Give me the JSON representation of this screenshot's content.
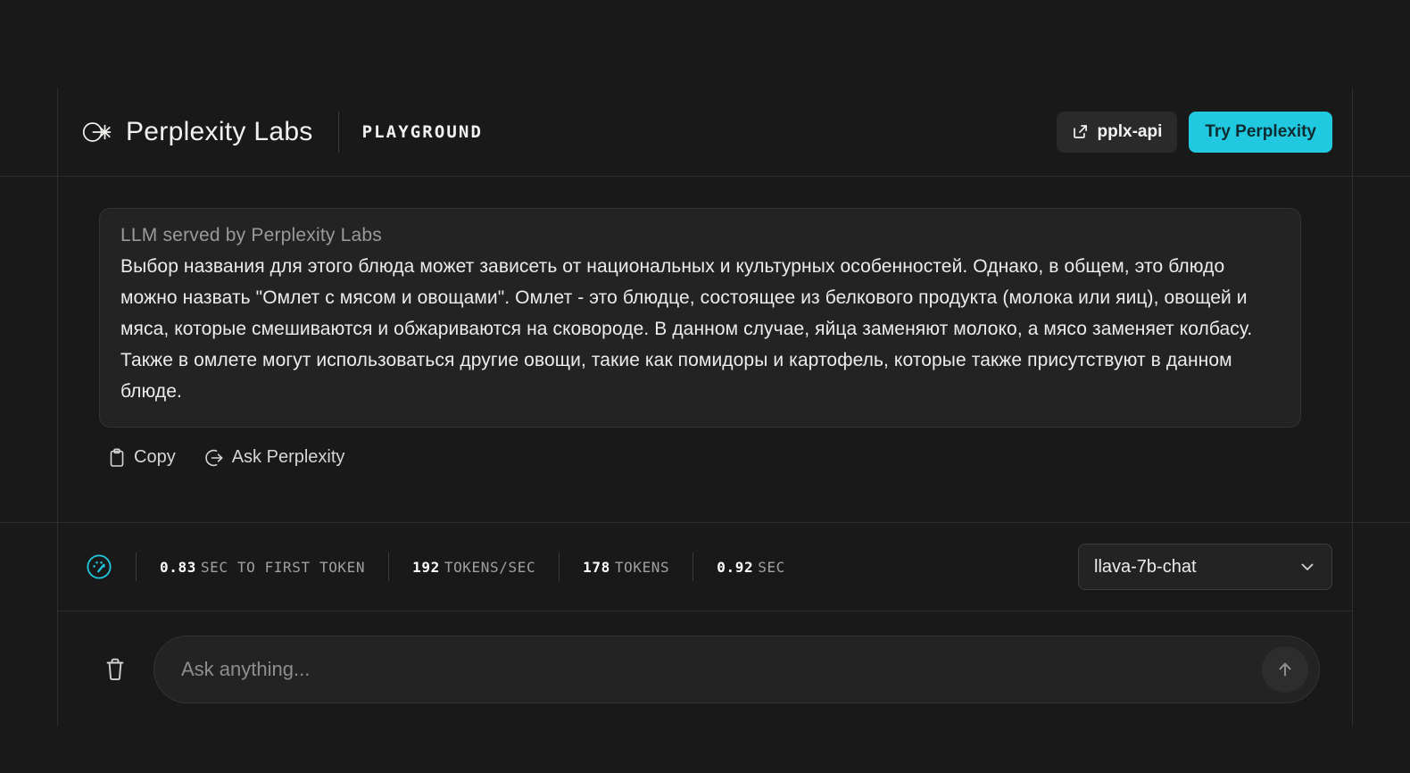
{
  "header": {
    "brand_name": "Perplexity Labs",
    "section_label": "PLAYGROUND",
    "api_button": "pplx-api",
    "try_button": "Try Perplexity",
    "accent_color": "#20c9df"
  },
  "response": {
    "card_label": "LLM served by Perplexity Labs",
    "text": "Выбор названия для этого блюда может зависеть от национальных и культурных особенностей. Однако, в общем, это блюдо можно назвать \"Омлет с мясом и овощами\". Омлет - это блюдце, состоящее из белкового продукта (молока или яиц), овощей и мяса, которые смешиваются и обжариваются на сковороде. В данном случае, яйца заменяют молоко, а мясо заменяет колбасу. Также в омлете могут использоваться другие овощи, такие как помидоры и картофель, которые также присутствуют в данном блюде.",
    "actions": [
      {
        "label": "Copy",
        "icon": "clipboard-icon"
      },
      {
        "label": "Ask Perplexity",
        "icon": "arrow-out-circle-icon"
      }
    ]
  },
  "stats": {
    "icon": "gauge-icon",
    "items": [
      {
        "value": "0.83",
        "unit": "SEC TO FIRST TOKEN"
      },
      {
        "value": "192",
        "unit": "TOKENS/SEC"
      },
      {
        "value": "178",
        "unit": "TOKENS"
      },
      {
        "value": "0.92",
        "unit": "SEC"
      }
    ],
    "model": "llava-7b-chat"
  },
  "input": {
    "placeholder": "Ask anything...",
    "value": "",
    "clear_icon": "trash-icon",
    "send_icon": "arrow-up-icon"
  }
}
